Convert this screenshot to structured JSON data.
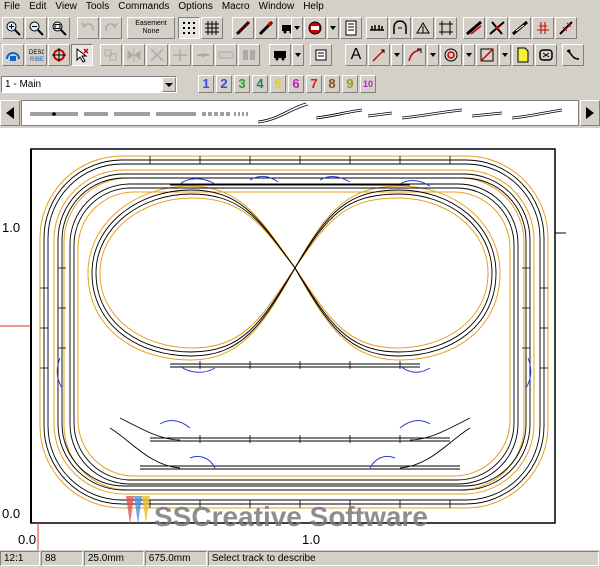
{
  "menu": [
    "File",
    "Edit",
    "View",
    "Tools",
    "Commands",
    "Options",
    "Macro",
    "Window",
    "Help"
  ],
  "toolbar": {
    "easement_title": "Easement",
    "easement_value": "None",
    "text_tool_label": "A"
  },
  "layer": {
    "current": "1 - Main",
    "buttons": [
      {
        "label": "1",
        "color": "#3a4ad8"
      },
      {
        "label": "2",
        "color": "#3a4ad8"
      },
      {
        "label": "3",
        "color": "#2ea02e"
      },
      {
        "label": "4",
        "color": "#1f7f7f"
      },
      {
        "label": "5",
        "color": "#e0d020"
      },
      {
        "label": "6",
        "color": "#c020c0"
      },
      {
        "label": "7",
        "color": "#d02020"
      },
      {
        "label": "8",
        "color": "#8a5020"
      },
      {
        "label": "9",
        "color": "#9c9c20"
      },
      {
        "label": "10",
        "color": "#c020c0"
      }
    ]
  },
  "canvas": {
    "y_labels": [
      "1.0",
      "0.0"
    ],
    "x_labels": [
      "0.0",
      "1.0"
    ],
    "watermark": "SSCreative Software",
    "colors": {
      "track": "#000000",
      "roadbed": "#e8a020",
      "turnout": "#2a3ad0",
      "ruler": "#e03030"
    }
  },
  "status": [
    "12:1",
    "88",
    "25.0mm",
    "675.0mm",
    "Select track to describe"
  ]
}
